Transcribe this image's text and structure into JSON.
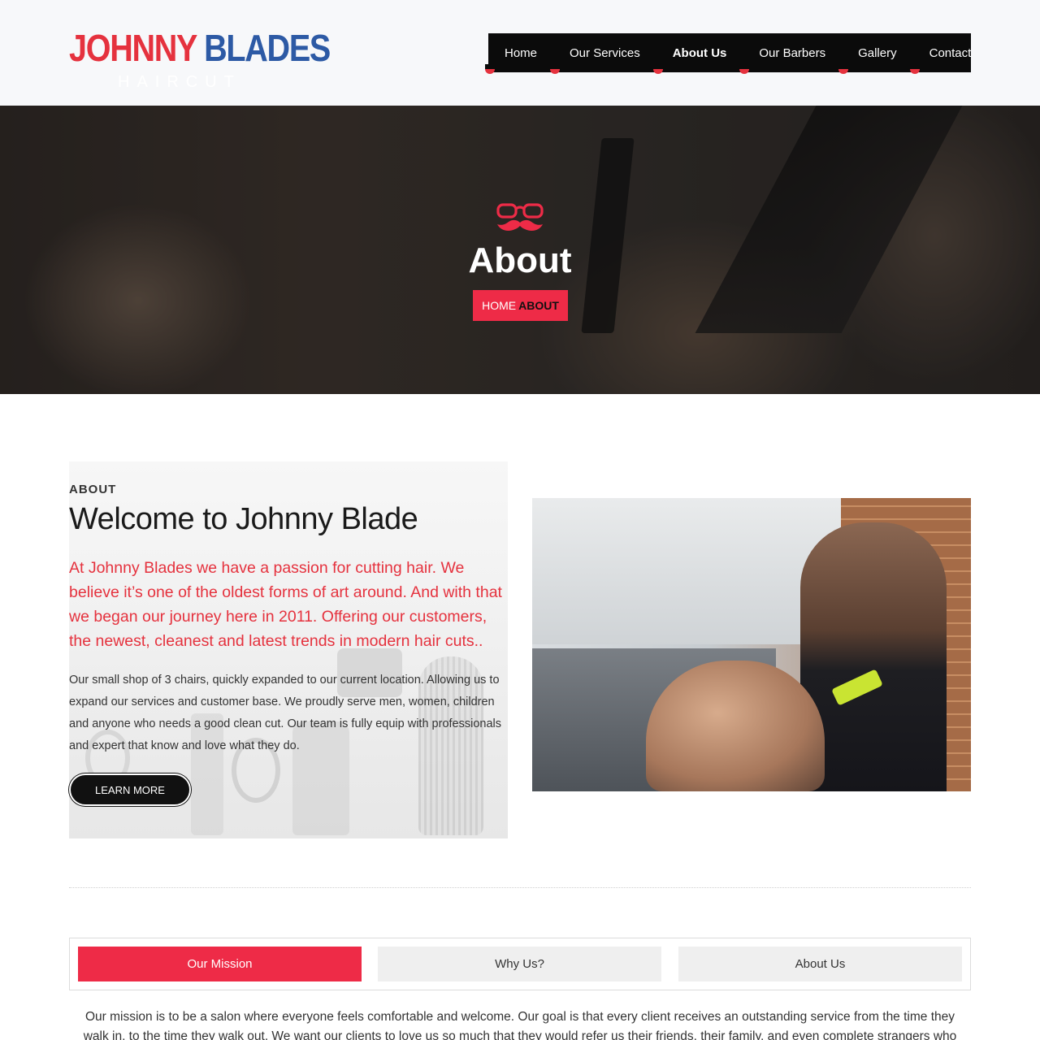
{
  "brand": {
    "name_part1": "JOHNNY",
    "name_part2": "BLADES",
    "tagline": "HAIRCUT",
    "color_red": "#e5323e",
    "color_blue": "#2d5aa5"
  },
  "nav": {
    "items": [
      {
        "label": "Home",
        "active": false
      },
      {
        "label": "Our Services",
        "active": false
      },
      {
        "label": "About Us",
        "active": true
      },
      {
        "label": "Our Barbers",
        "active": false
      },
      {
        "label": "Gallery",
        "active": false
      },
      {
        "label": "Contact",
        "active": false
      }
    ]
  },
  "hero": {
    "icon": "glasses-mustache-icon",
    "title": "About",
    "breadcrumb_home": "HOME",
    "breadcrumb_current": "ABOUT",
    "accent": "#ee2b47"
  },
  "about": {
    "eyebrow": "ABOUT",
    "title": "Welcome to Johnny Blade",
    "lead": "At Johnny Blades we have a passion for cutting hair. We believe it’s one of the oldest forms of art around. And with that we began our journey here in 2011. Offering our customers, the newest, cleanest and latest trends in modern hair cuts..",
    "body": "Our small shop of 3 chairs, quickly expanded to our current location. Allowing us to expand our services and customer base. We proudly serve men, women, children and anyone who needs a good clean cut. Our team is fully equip with professionals and expert that know and love what they do.",
    "button_label": "LEARN MORE"
  },
  "tabs": {
    "items": [
      {
        "label": "Our Mission",
        "active": true
      },
      {
        "label": "Why Us?",
        "active": false
      },
      {
        "label": "About Us",
        "active": false
      }
    ],
    "content": "Our mission is to be a salon where everyone feels comfortable and welcome. Our goal is that every client receives an outstanding service from the time they walk in, to the time they walk out. We want our clients to love us so much that they would refer us their friends, their family, and even complete strangers who approach them."
  }
}
